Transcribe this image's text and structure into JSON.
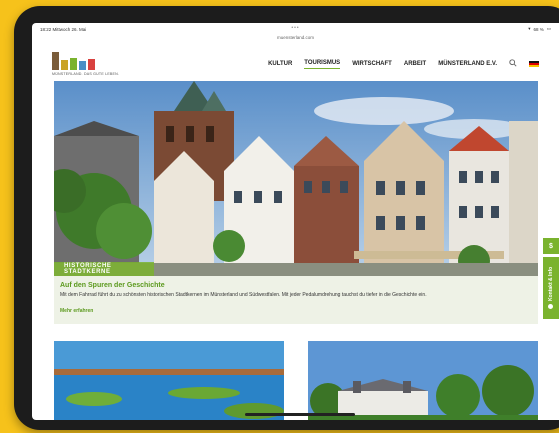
{
  "status": {
    "time": "18:22",
    "date": "Mittwoch 26. Mai",
    "battery": "68 %",
    "url": "muensterland.com",
    "dots": "•••"
  },
  "logo": {
    "tagline": "MÜNSTERLAND. DAS GUTE LEBEN.",
    "colors": [
      "#7a5c3a",
      "#c9a227",
      "#7ab32e",
      "#4a8fc6",
      "#d9413f"
    ]
  },
  "nav": {
    "items": [
      "KULTUR",
      "TOURISMUS",
      "WIRTSCHAFT",
      "ARBEIT",
      "MÜNSTERLAND E.V."
    ],
    "active_index": 1,
    "search_icon": "search-icon",
    "language_flag": "german-flag-icon"
  },
  "hero": {
    "label": "HISTORISCHE STADTKERNE"
  },
  "teaser": {
    "title": "Auf den Spuren der Geschichte",
    "text": "Mit dem Fahrrad führt du zu schönsten historischen Stadtkernen im Münsterland und Südwestfalen. Mit jeder Pedalumdrehung tauchst du tiefer in die Geschichte ein.",
    "link": "Mehr erfahren"
  },
  "side_tabs": {
    "euro_label": "$",
    "contact_label": "Kontakt & Info"
  },
  "colors": {
    "accent": "#7ab32e",
    "accent_dark": "#5c9a1e",
    "background": "#f6c21b"
  }
}
